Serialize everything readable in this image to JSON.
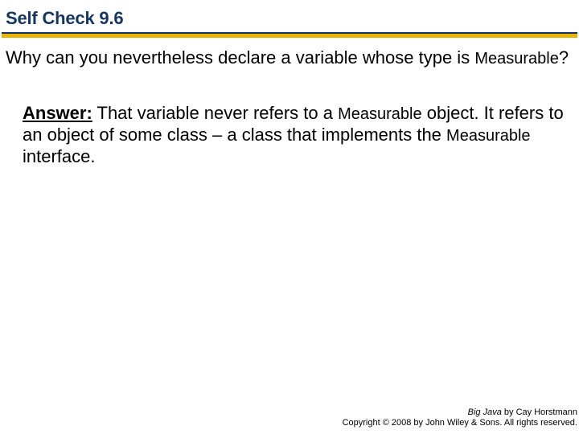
{
  "title": "Self Check 9.6",
  "question": {
    "pre": "Why can you nevertheless declare a variable whose type is ",
    "code": "Measurable",
    "post": "?"
  },
  "answer": {
    "label": "Answer:",
    "part1": " That variable never refers to a ",
    "code1": "Measurable",
    "part2": " object. It refers to an object of some class – a class that implements the ",
    "code2": "Measurable",
    "part3": " interface."
  },
  "footer": {
    "book": "Big Java",
    "byline": " by Cay Horstmann",
    "copyright": "Copyright © 2008 by John Wiley & Sons.  All rights reserved."
  }
}
